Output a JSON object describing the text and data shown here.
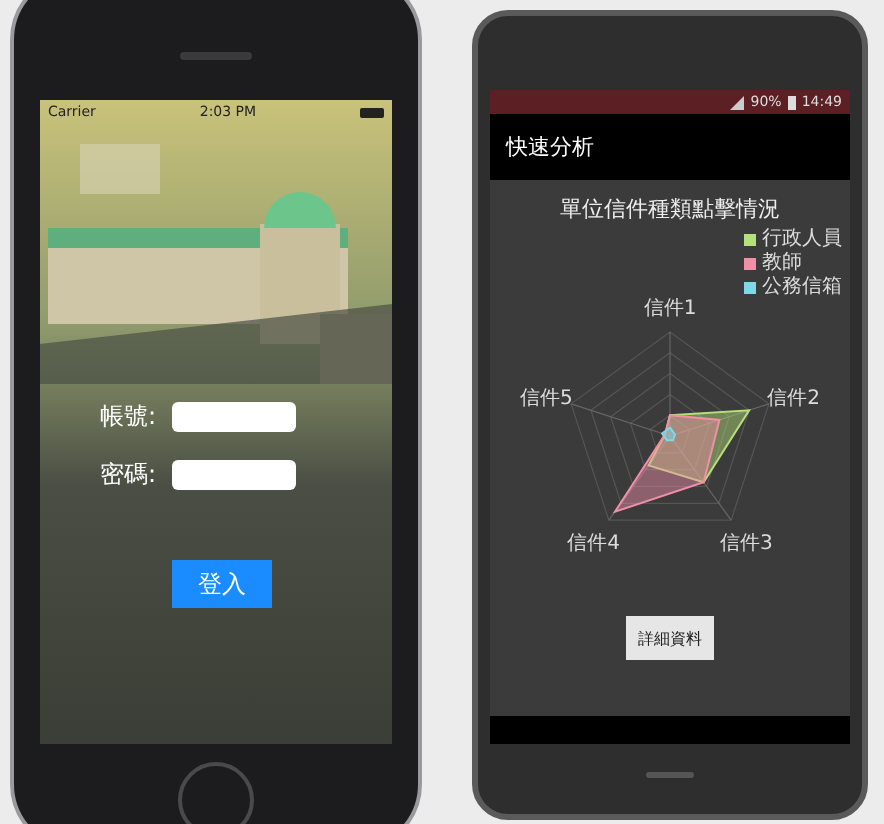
{
  "ios_phone": {
    "status_bar": {
      "carrier": "Carrier",
      "time": "2:03 PM"
    },
    "login_form": {
      "fields": [
        {
          "label": "帳號:"
        },
        {
          "label": "密碼:"
        }
      ],
      "login_button": "登入"
    }
  },
  "android_phone": {
    "status_bar": {
      "battery": "90%",
      "time": "14:49"
    },
    "app_bar": {
      "title": "快速分析"
    },
    "chart_title": "單位信件種類點擊情況",
    "legend": [
      {
        "label": "行政人員",
        "color": "#b5e07a"
      },
      {
        "label": "教師",
        "color": "#f08fa8"
      },
      {
        "label": "公務信箱",
        "color": "#7fd8e8"
      }
    ],
    "axes": [
      "信件1",
      "信件2",
      "信件3",
      "信件4",
      "信件5"
    ],
    "details_button": "詳細資料"
  }
}
